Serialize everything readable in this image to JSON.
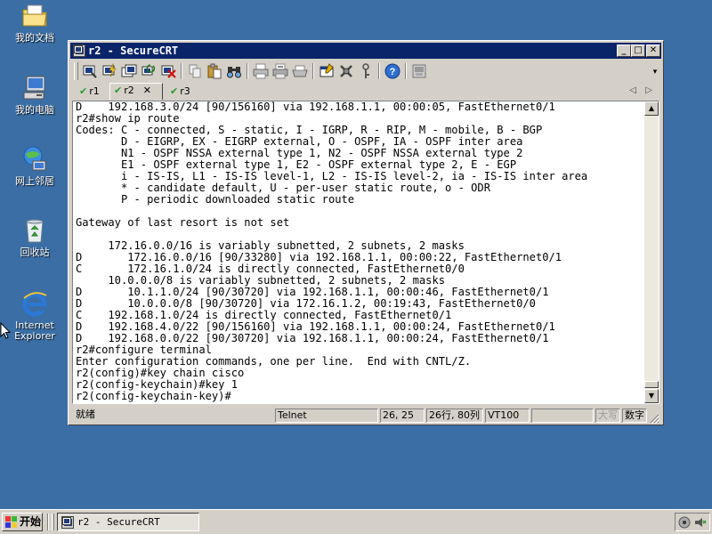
{
  "desktop": {
    "icons": [
      {
        "label": "我的文档",
        "icon": "my-documents-icon"
      },
      {
        "label": "我的电脑",
        "icon": "my-computer-icon"
      },
      {
        "label": "网上邻居",
        "icon": "network-places-icon"
      },
      {
        "label": "回收站",
        "icon": "recycle-bin-icon"
      },
      {
        "label_line1": "Internet",
        "label_line2": "Explorer",
        "icon": "internet-explorer-icon"
      }
    ]
  },
  "window": {
    "title": "r2 - SecureCRT",
    "min_label": "_",
    "max_label": "□",
    "close_label": "✕"
  },
  "tabs": [
    {
      "label": "r1",
      "active": false
    },
    {
      "label": "r2",
      "active": true,
      "close": "✕"
    },
    {
      "label": "r3",
      "active": false
    }
  ],
  "tab_nav": {
    "prev": "◁",
    "next": "▷"
  },
  "terminal": {
    "lines": [
      "D    192.168.3.0/24 [90/156160] via 192.168.1.1, 00:00:05, FastEthernet0/1",
      "r2#show ip route",
      "Codes: C - connected, S - static, I - IGRP, R - RIP, M - mobile, B - BGP",
      "       D - EIGRP, EX - EIGRP external, O - OSPF, IA - OSPF inter area",
      "       N1 - OSPF NSSA external type 1, N2 - OSPF NSSA external type 2",
      "       E1 - OSPF external type 1, E2 - OSPF external type 2, E - EGP",
      "       i - IS-IS, L1 - IS-IS level-1, L2 - IS-IS level-2, ia - IS-IS inter area",
      "       * - candidate default, U - per-user static route, o - ODR",
      "       P - periodic downloaded static route",
      "",
      "Gateway of last resort is not set",
      "",
      "     172.16.0.0/16 is variably subnetted, 2 subnets, 2 masks",
      "D       172.16.0.0/16 [90/33280] via 192.168.1.1, 00:00:22, FastEthernet0/1",
      "C       172.16.1.0/24 is directly connected, FastEthernet0/0",
      "     10.0.0.0/8 is variably subnetted, 2 subnets, 2 masks",
      "D       10.1.1.0/24 [90/30720] via 192.168.1.1, 00:00:46, FastEthernet0/1",
      "D       10.0.0.0/8 [90/30720] via 172.16.1.2, 00:19:43, FastEthernet0/0",
      "C    192.168.1.0/24 is directly connected, FastEthernet0/1",
      "D    192.168.4.0/22 [90/156160] via 192.168.1.1, 00:00:24, FastEthernet0/1",
      "D    192.168.0.0/22 [90/30720] via 192.168.1.1, 00:00:24, FastEthernet0/1",
      "r2#configure terminal",
      "Enter configuration commands, one per line.  End with CNTL/Z.",
      "r2(config)#key chain cisco",
      "r2(config-keychain)#key 1",
      "r2(config-keychain-key)#"
    ]
  },
  "scrollbar": {
    "up": "▲",
    "down": "▼"
  },
  "status": {
    "ready": "就绪",
    "protocol": "Telnet",
    "cursor_pos": "26, 25",
    "rows_cols": "26行, 80列",
    "emulation": "VT100",
    "empty": "",
    "caps": "大写",
    "num": "数字"
  },
  "taskbar": {
    "start_label": "开始",
    "task_title": "r2 - SecureCRT"
  },
  "toolbar_icons": [
    "connect-icon",
    "quick-connect-icon",
    "connect-tab-icon",
    "reconnect-icon",
    "disconnect-icon",
    "copy-icon",
    "paste-icon",
    "find-icon",
    "print-icon",
    "print-selection-icon",
    "print-setup-icon",
    "session-options-icon",
    "global-options-icon",
    "keymap-icon",
    "help-icon",
    "sftp-icon"
  ]
}
